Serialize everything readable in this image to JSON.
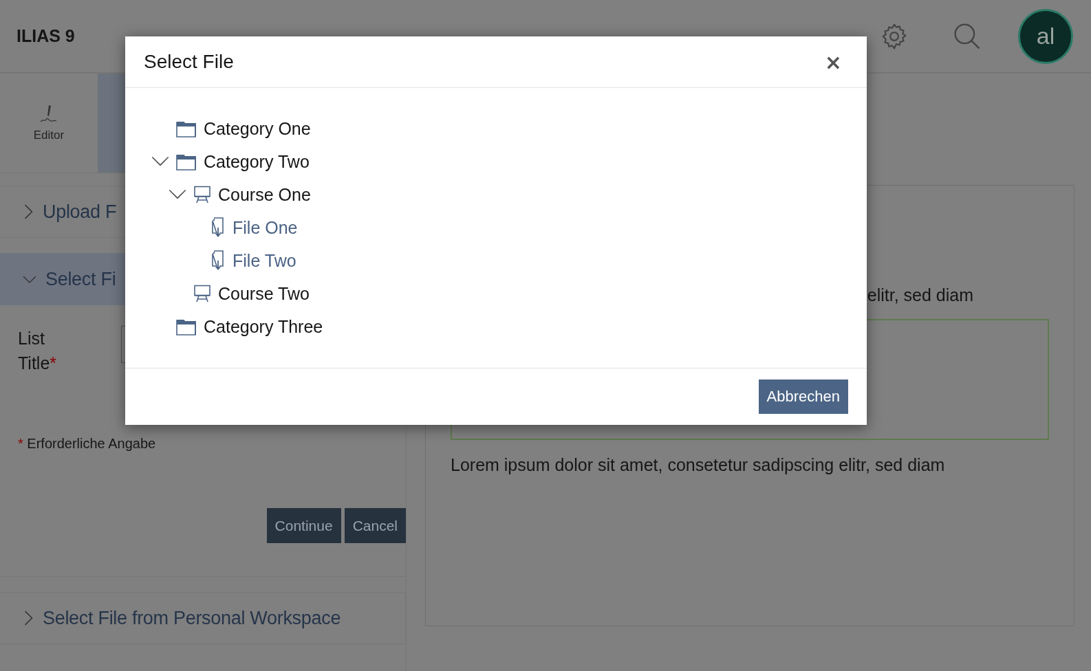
{
  "header": {
    "title": "ILIAS 9",
    "avatar": "al"
  },
  "tabs": [
    {
      "label": "Editor",
      "selected": false
    },
    {
      "selected": true
    }
  ],
  "accordions": [
    {
      "title": "Upload F",
      "expanded": false
    },
    {
      "title": "Select Fi",
      "expanded": true
    },
    {
      "title": "Select File from Personal Workspace",
      "expanded": false
    }
  ],
  "form": {
    "label": "List Title",
    "required_mark": "*",
    "note_mark": "*",
    "note": "Erforderliche Angabe",
    "buttons": [
      "Continue",
      "Cancel"
    ]
  },
  "content": {
    "line_1": "elitr, sed diam",
    "line_2": "Lorem ipsum dolor sit amet, consetetur sadipscing elitr, sed diam"
  },
  "modal": {
    "title": "Select File",
    "close": "×",
    "tree": [
      {
        "kind": "category",
        "label": "Category One"
      },
      {
        "kind": "category",
        "label": "Category Two",
        "expanded": true,
        "children": [
          {
            "kind": "course",
            "label": "Course One",
            "expanded": true,
            "children": [
              {
                "kind": "file",
                "label": "File One"
              },
              {
                "kind": "file",
                "label": "File Two"
              }
            ]
          },
          {
            "kind": "course",
            "label": "Course Two"
          }
        ]
      },
      {
        "kind": "category",
        "label": "Category Three"
      }
    ],
    "buttons": [
      "Abbrechen"
    ]
  }
}
